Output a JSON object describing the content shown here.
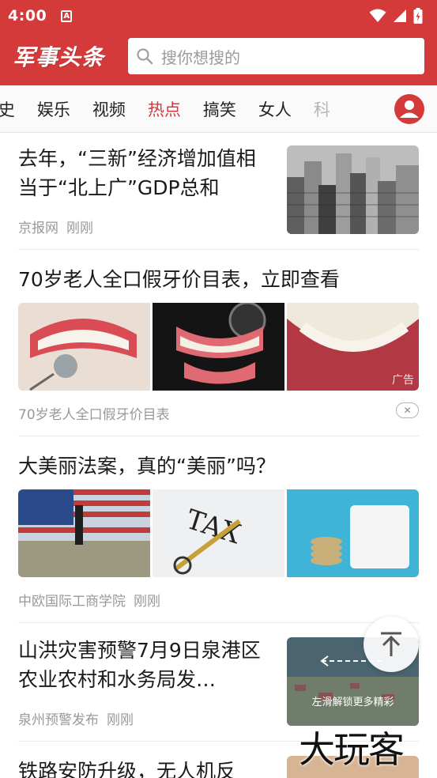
{
  "status_bar": {
    "time": "4:00",
    "notification_glyph": "A"
  },
  "header": {
    "logo": "军事头条",
    "search_placeholder": "搜你想搜的"
  },
  "tabs": [
    {
      "label": "历史",
      "partial": "i史"
    },
    {
      "label": "娱乐"
    },
    {
      "label": "视频"
    },
    {
      "label": "热点",
      "active": true
    },
    {
      "label": "搞笑"
    },
    {
      "label": "女人"
    },
    {
      "label": "科"
    }
  ],
  "feed": [
    {
      "title": "去年，“三新”经济增加值相当于“北上广”GDP总和",
      "source": "京报网",
      "time": "刚刚"
    },
    {
      "title": "70岁老人全口假牙价目表，立即查看",
      "subtitle": "70岁老人全口假牙价目表",
      "ad_label": "广告"
    },
    {
      "title": "大美丽法案，真的“美丽”吗？",
      "source": "中欧国际工商学院",
      "time": "刚刚"
    },
    {
      "title": "山洪灾害预警7月9日泉港区农业农村和水务局发…",
      "source": "泉州预警发布",
      "time": "刚刚",
      "thumb_overlay": "左滑解锁更多精彩"
    },
    {
      "title": "铁路安防升级，无人机反"
    }
  ],
  "watermark": "大玩客",
  "colors": {
    "brand_red": "#d43a3a",
    "muted_text": "#999999"
  }
}
